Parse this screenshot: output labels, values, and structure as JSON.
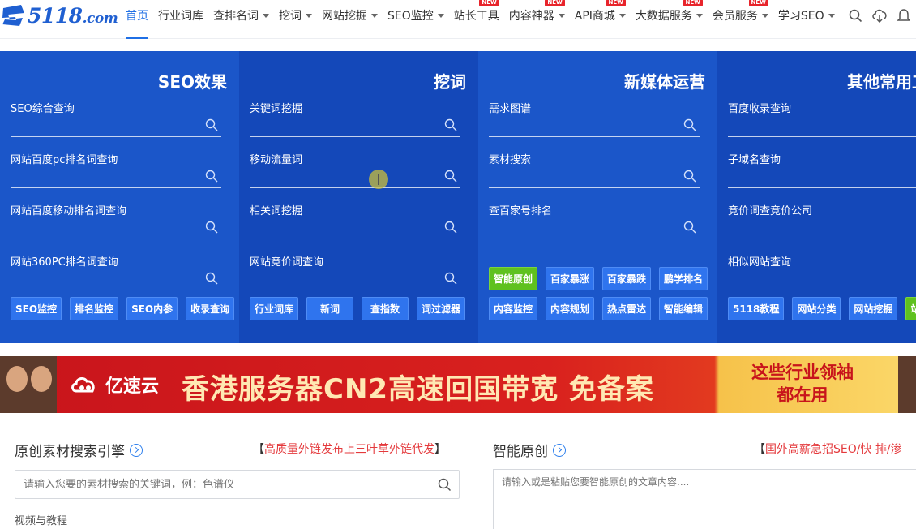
{
  "nav": {
    "logo_text": "5118",
    "logo_suffix": ".com",
    "items": [
      {
        "label": "首页",
        "active": true,
        "caret": false,
        "new": false
      },
      {
        "label": "行业词库",
        "caret": false,
        "new": false
      },
      {
        "label": "查排名词",
        "caret": true,
        "new": false
      },
      {
        "label": "挖词",
        "caret": true,
        "new": false
      },
      {
        "label": "网站挖掘",
        "caret": true,
        "new": false
      },
      {
        "label": "SEO监控",
        "caret": true,
        "new": false
      },
      {
        "label": "站长工具",
        "caret": false,
        "new": true
      },
      {
        "label": "内容神器",
        "caret": true,
        "new": true
      },
      {
        "label": "API商城",
        "caret": true,
        "new": true
      },
      {
        "label": "大数据服务",
        "caret": true,
        "new": true
      },
      {
        "label": "会员服务",
        "caret": true,
        "new": true
      },
      {
        "label": "学习SEO",
        "caret": true,
        "new": false
      }
    ],
    "new_tag": "NEW",
    "icons": [
      "search-icon",
      "cloud-download-icon",
      "bell-icon"
    ]
  },
  "tools": [
    {
      "title": "SEO效果",
      "fields": [
        "SEO综合查询",
        "网站百度pc排名词查询",
        "网站百度移动排名词查询",
        "网站360PC排名词查询"
      ],
      "buttons": [
        {
          "label": "SEO监控"
        },
        {
          "label": "排名监控"
        },
        {
          "label": "SEO内参"
        },
        {
          "label": "收录查询"
        }
      ]
    },
    {
      "title": "挖词",
      "fields": [
        "关键词挖掘",
        "移动流量词",
        "相关词挖掘",
        "网站竞价词查询"
      ],
      "buttons": [
        {
          "label": "行业词库"
        },
        {
          "label": "新词"
        },
        {
          "label": "查指数"
        },
        {
          "label": "词过滤器"
        }
      ]
    },
    {
      "title": "新媒体运营",
      "fields": [
        "需求图谱",
        "素材搜索",
        "查百家号排名"
      ],
      "buttons_top": [
        {
          "label": "智能原创",
          "green": true
        },
        {
          "label": "百家暴涨"
        },
        {
          "label": "百家暴跌"
        },
        {
          "label": "鹏学排名"
        }
      ],
      "buttons": [
        {
          "label": "内容监控"
        },
        {
          "label": "内容规划"
        },
        {
          "label": "热点雷达"
        },
        {
          "label": "智能编辑"
        }
      ]
    },
    {
      "title": "其他常用工",
      "fields": [
        "百度收录查询",
        "子域名查询",
        "竞价词查竞价公司",
        "相似网站查询"
      ],
      "buttons": [
        {
          "label": "5118教程"
        },
        {
          "label": "网站分类"
        },
        {
          "label": "网站挖掘"
        },
        {
          "label": "站长",
          "green": true
        }
      ]
    }
  ],
  "banner": {
    "brand": "亿速云",
    "slogan": "香港服务器CN2高速回国带宽 免备案",
    "right_line1": "这些行业领袖",
    "right_line2": "都在用"
  },
  "left_section": {
    "title": "原创素材搜索引擎",
    "link_prefix": "【",
    "link": "高质量外链发布上三叶草外链代发",
    "link_suffix": "】",
    "search_placeholder": "请输入您要的素材搜索的关键词，例：色谱仪",
    "sub_label": "视频与教程"
  },
  "right_section": {
    "title": "智能原创",
    "link_prefix": "【",
    "link": "国外高薪急招SEO/快 排/渗",
    "textarea_placeholder": "请输入或是粘贴您要智能原创的文章内容...."
  },
  "colors": {
    "brand_blue": "#1f5fd1",
    "panel_blue": "#1b56c9",
    "panel_blue_dark": "#1448b9",
    "button_blue": "#2f74ee",
    "button_green": "#5fc11f",
    "link_red": "#e4393c"
  }
}
